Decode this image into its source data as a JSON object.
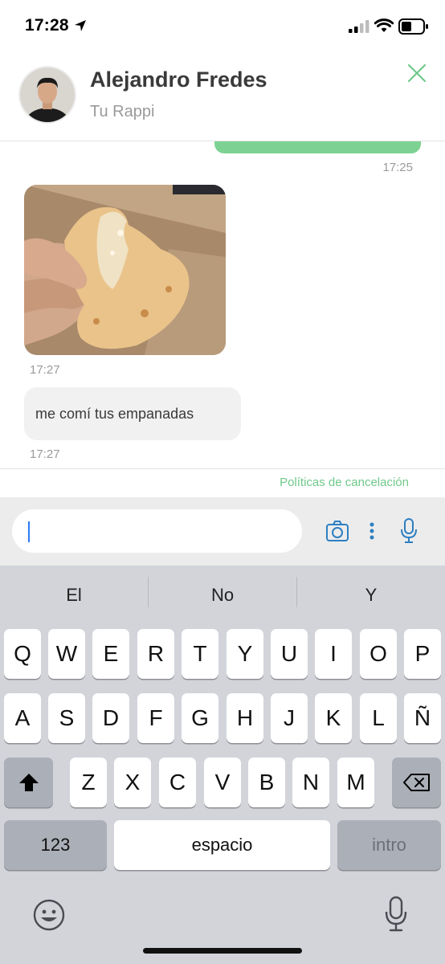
{
  "status_bar": {
    "time": "17:28"
  },
  "header": {
    "contact_name": "Alejandro Fredes",
    "subtitle": "Tu Rappi"
  },
  "messages": {
    "outgoing_time": "17:25",
    "photo_time": "17:27",
    "text_message": "me comí tus empanadas",
    "text_time": "17:27"
  },
  "footer": {
    "policy_link": "Políticas de cancelación"
  },
  "composer": {
    "value": "",
    "placeholder": ""
  },
  "keyboard": {
    "suggestions": [
      "El",
      "No",
      "Y"
    ],
    "row1": [
      "Q",
      "W",
      "E",
      "R",
      "T",
      "Y",
      "U",
      "I",
      "O",
      "P"
    ],
    "row2": [
      "A",
      "S",
      "D",
      "F",
      "G",
      "H",
      "J",
      "K",
      "L",
      "Ñ"
    ],
    "row3": [
      "Z",
      "X",
      "C",
      "V",
      "B",
      "N",
      "M"
    ],
    "numbers_key": "123",
    "space_key": "espacio",
    "return_key": "intro"
  },
  "colors": {
    "accent": "#6fc98a",
    "outgoing_bubble": "#7dd293",
    "icon_blue": "#2d7fc1"
  }
}
